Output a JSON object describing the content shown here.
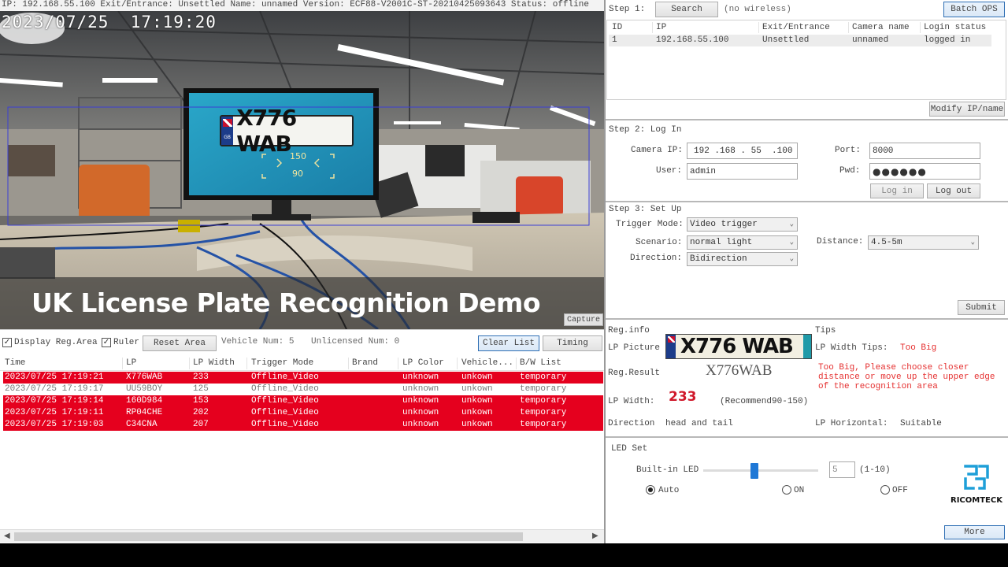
{
  "status_bar": "IP: 192.168.55.100 Exit/Entrance: Unsettled Name: unnamed Version: ECF88-V2001C-ST-20210425093643 Status: offline",
  "video": {
    "timestamp": "2023/07/25  17:19:20",
    "plate_text": "X776 WAB",
    "plate_flag": "GB",
    "detect_top": "150",
    "detect_bottom": "90",
    "banner": "UK License Plate Recognition Demo",
    "capture_label": "Capture"
  },
  "list_toolbar": {
    "display_reg_area": "Display Reg.Area",
    "ruler": "Ruler",
    "reset_area": "Reset Area",
    "vehicle_num": "Vehicle Num: 5",
    "unlicensed_num": "Unlicensed Num: 0",
    "clear_list": "Clear List",
    "timing": "Timing"
  },
  "records": {
    "columns": [
      "Time",
      "LP",
      "LP Width",
      "Trigger Mode",
      "Brand",
      "LP Color",
      "Vehicle...",
      "B/W List"
    ],
    "rows": [
      {
        "time": "2023/07/25 17:19:21",
        "lp": "X776WAB",
        "width": "233",
        "trigger": "Offline_Video",
        "brand": "",
        "color": "unknown",
        "vehicle": "unkown",
        "bw": "temporary",
        "highlight": true
      },
      {
        "time": "2023/07/25 17:19:17",
        "lp": "UU59BOY",
        "width": "125",
        "trigger": "Offline_Video",
        "brand": "",
        "color": "unknown",
        "vehicle": "unkown",
        "bw": "temporary",
        "highlight": false
      },
      {
        "time": "2023/07/25 17:19:14",
        "lp": "160D984",
        "width": "153",
        "trigger": "Offline_Video",
        "brand": "",
        "color": "unknown",
        "vehicle": "unkown",
        "bw": "temporary",
        "highlight": true
      },
      {
        "time": "2023/07/25 17:19:11",
        "lp": "RP04CHE",
        "width": "202",
        "trigger": "Offline_Video",
        "brand": "",
        "color": "unknown",
        "vehicle": "unkown",
        "bw": "temporary",
        "highlight": true
      },
      {
        "time": "2023/07/25 17:19:03",
        "lp": "C34CNA",
        "width": "207",
        "trigger": "Offline_Video",
        "brand": "",
        "color": "unknown",
        "vehicle": "unkown",
        "bw": "temporary",
        "highlight": true
      }
    ]
  },
  "step1": {
    "title": "Step 1:",
    "search": "Search",
    "wireless": "(no wireless)",
    "batch_ops": "Batch OPS",
    "columns": [
      "ID",
      "IP",
      "Exit/Entrance",
      "Camera name",
      "Login status"
    ],
    "rows": [
      {
        "id": "1",
        "ip": "192.168.55.100",
        "exit": "Unsettled",
        "name": "unnamed",
        "status": "logged in"
      }
    ],
    "modify": "Modify IP/name"
  },
  "step2": {
    "title": "Step 2: Log In",
    "camera_ip_label": "Camera IP:",
    "camera_ip_value": "192 .168 . 55  .100",
    "port_label": "Port:",
    "port_value": "8000",
    "user_label": "User:",
    "user_value": "admin",
    "pwd_label": "Pwd:",
    "pwd_value": "●●●●●●",
    "login": "Log in",
    "logout": "Log out"
  },
  "step3": {
    "title": "Step 3: Set Up",
    "trigger_label": "Trigger Mode:",
    "trigger_value": "Video trigger",
    "scenario_label": "Scenario:",
    "scenario_value": "normal light",
    "distance_label": "Distance:",
    "distance_value": "4.5-5m",
    "direction_label": "Direction:",
    "direction_value": "Bidirection",
    "submit": "Submit"
  },
  "reginfo": {
    "title": "Reg.info",
    "lp_picture_label": "LP Picture",
    "plate_text": "X776 WAB",
    "reg_result_label": "Reg.Result",
    "reg_result_value": "X776WAB",
    "lp_width_label": "LP Width:",
    "lp_width_value": "233",
    "recommend": "(Recommend90-150)",
    "direction_label": "Direction",
    "direction_value": "head and tail",
    "tips_title": "Tips",
    "width_tips_label": "LP Width Tips:",
    "width_tips_value": "Too Big",
    "tips_message": "Too Big, Please choose closer distance or move up the upper edge of the recognition area",
    "horizontal_label": "LP Horizontal:",
    "horizontal_value": "Suitable"
  },
  "led": {
    "title": "LED Set",
    "builtin_label": "Built-in LED",
    "level_value": "5",
    "level_fraction": 0.44,
    "range": "(1-10)",
    "mode_auto": "Auto",
    "mode_on": "ON",
    "mode_off": "OFF",
    "selected": "auto",
    "more": "More"
  },
  "brand": {
    "name": "RICOMTECK"
  },
  "colors": {
    "highlight_row": "#e5001e",
    "accent_border": "#2f6fb4",
    "tips_red": "#e53030",
    "width_red": "#d0192b"
  }
}
